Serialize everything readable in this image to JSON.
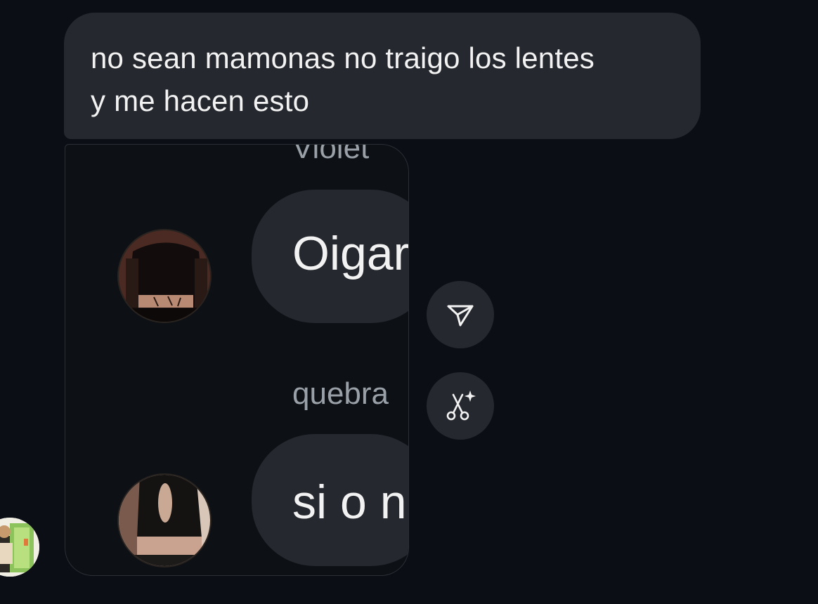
{
  "message": {
    "text_line1": "no sean mamonas no traigo los lentes",
    "text_line2": "y me hacen esto"
  },
  "screenshot": {
    "top_sender_partial": "Violet",
    "message1_partial": "Oigar",
    "sender2_partial": "quebra",
    "message2_partial": "si o n"
  },
  "actions": [
    {
      "name": "share-button",
      "icon": "send-icon"
    },
    {
      "name": "cut-out-button",
      "icon": "scissors-sparkle-icon"
    }
  ],
  "colors": {
    "background": "#0b0f15",
    "bubble": "#25282e",
    "text": "#f2f2f2",
    "muted_text": "#9aa0a8"
  }
}
